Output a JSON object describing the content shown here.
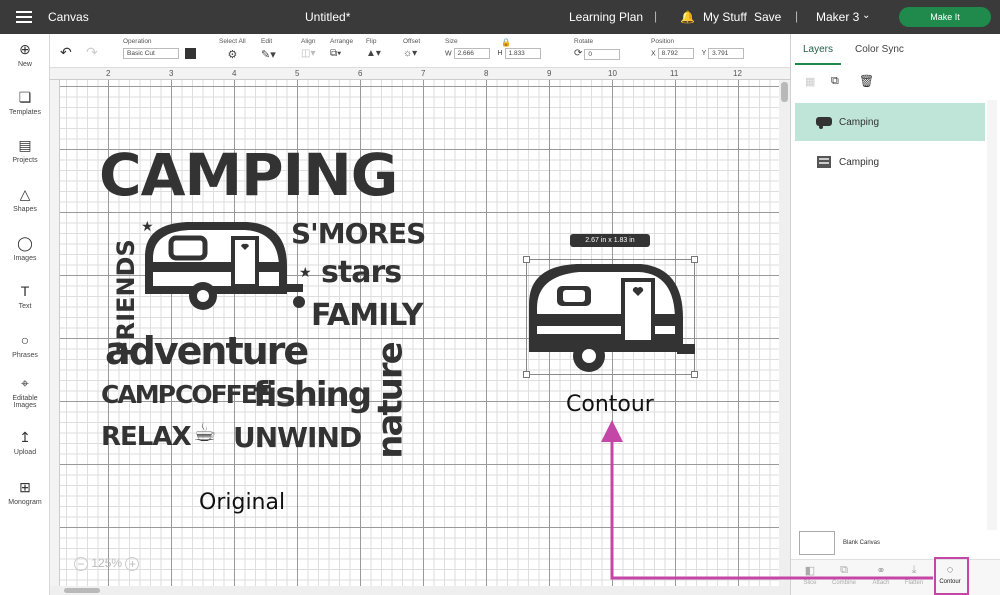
{
  "topbar": {
    "canvas": "Canvas",
    "title": "Untitled*",
    "learning": "Learning Plan",
    "mystuff": "My Stuff",
    "save": "Save",
    "machine": "Maker 3",
    "make_it": "Make It"
  },
  "sidebar": {
    "items": [
      {
        "label": "New",
        "icon": "plus-circle-icon"
      },
      {
        "label": "Templates",
        "icon": "shirt-icon"
      },
      {
        "label": "Projects",
        "icon": "projects-icon"
      },
      {
        "label": "Shapes",
        "icon": "shapes-icon"
      },
      {
        "label": "Images",
        "icon": "bulb-icon"
      },
      {
        "label": "Text",
        "icon": "text-icon"
      },
      {
        "label": "Phrases",
        "icon": "speech-icon"
      },
      {
        "label": "Editable",
        "label2": "Images",
        "icon": "editable-icon"
      },
      {
        "label": "Upload",
        "icon": "upload-icon"
      },
      {
        "label": "Monogram",
        "icon": "monogram-icon"
      }
    ]
  },
  "toolbar": {
    "operation_label": "Operation",
    "operation_value": "Basic Cut",
    "selectall": "Select All",
    "edit": "Edit",
    "align": "Align",
    "arrange": "Arrange",
    "flip": "Flip",
    "offset": "Offset",
    "size": "Size",
    "w_label": "W",
    "w": "2.666",
    "h_label": "H",
    "h": "1.833",
    "rotate": "Rotate",
    "rotate_value": "0",
    "position": "Position",
    "x_label": "X",
    "x": "8.792",
    "y_label": "Y",
    "y": "3.791"
  },
  "ruler": {
    "numbers": [
      "2",
      "3",
      "4",
      "5",
      "6",
      "7",
      "8",
      "9",
      "10",
      "11",
      "12"
    ]
  },
  "canvas": {
    "zoom": "125%",
    "dims": "2.67  in x 1.83  in",
    "original_label": "Original",
    "contour_label": "Contour"
  },
  "design": {
    "camping": "CAMPING",
    "friends": "FRIENDS",
    "smores": "S'MORES",
    "stars": "stars",
    "family": "FAMILY",
    "adventure": "adventure",
    "camp": "CAMP",
    "coffee": "COFFEE",
    "fishing": "fishing",
    "nature": "nature",
    "relax": "RELAX",
    "unwind": "UNWIND"
  },
  "panel": {
    "tab_layers": "Layers",
    "tab_colorsync": "Color Sync",
    "layers": [
      {
        "name": "Camping"
      },
      {
        "name": "Camping"
      }
    ],
    "blank_canvas": "Blank Canvas"
  },
  "bottom_tools": [
    {
      "label": "Slice"
    },
    {
      "label": "Combine"
    },
    {
      "label": "Attach"
    },
    {
      "label": "Flatten"
    },
    {
      "label": "Contour"
    }
  ],
  "colors": {
    "accent": "#1f8a4c",
    "highlight": "#bfe5d8",
    "annotation": "#c447a7",
    "topbar": "#3a3a3a"
  }
}
